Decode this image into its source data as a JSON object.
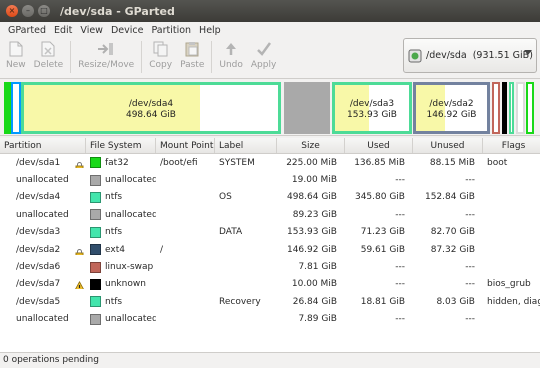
{
  "window": {
    "title": "/dev/sda - GParted"
  },
  "menu": [
    "GParted",
    "Edit",
    "View",
    "Device",
    "Partition",
    "Help"
  ],
  "toolbar": {
    "new": "New",
    "delete": "Delete",
    "resize_move": "Resize/Move",
    "copy": "Copy",
    "paste": "Paste",
    "undo": "Undo",
    "apply": "Apply"
  },
  "device_selector": {
    "device": "/dev/sda",
    "size": "(931.51 GiB)"
  },
  "graph": {
    "sda4": {
      "name": "/dev/sda4",
      "size": "498.64 GiB",
      "used_fraction": 0.693,
      "color": "#4ddb97"
    },
    "sda3": {
      "name": "/dev/sda3",
      "size": "153.93 GiB",
      "used_fraction": 0.463,
      "color": "#4ddb97"
    },
    "sda2": {
      "name": "/dev/sda2",
      "size": "146.92 GiB",
      "used_fraction": 0.406,
      "color": "#73829f"
    }
  },
  "columns": {
    "partition": "Partition",
    "filesystem": "File System",
    "mountpoint": "Mount Point",
    "label": "Label",
    "size": "Size",
    "used": "Used",
    "unused": "Unused",
    "flags": "Flags"
  },
  "rows": [
    {
      "partition": "/dev/sda1",
      "fs": "fat32",
      "fs_color": "#18d918",
      "mount": "/boot/efi",
      "label": "SYSTEM",
      "size": "225.00 MiB",
      "used": "136.85 MiB",
      "unused": "88.15 MiB",
      "flags": "boot",
      "icon": "lock-icon"
    },
    {
      "partition": "unallocated",
      "fs": "unallocated",
      "fs_color": "#a9a9a9",
      "mount": "",
      "label": "",
      "size": "19.00 MiB",
      "used": "---",
      "unused": "---",
      "flags": "",
      "icon": ""
    },
    {
      "partition": "/dev/sda4",
      "fs": "ntfs",
      "fs_color": "#42e5ac",
      "mount": "",
      "label": "OS",
      "size": "498.64 GiB",
      "used": "345.80 GiB",
      "unused": "152.84 GiB",
      "flags": "",
      "icon": ""
    },
    {
      "partition": "unallocated",
      "fs": "unallocated",
      "fs_color": "#a9a9a9",
      "mount": "",
      "label": "",
      "size": "89.23 GiB",
      "used": "---",
      "unused": "---",
      "flags": "",
      "icon": ""
    },
    {
      "partition": "/dev/sda3",
      "fs": "ntfs",
      "fs_color": "#42e5ac",
      "mount": "",
      "label": "DATA",
      "size": "153.93 GiB",
      "used": "71.23 GiB",
      "unused": "82.70 GiB",
      "flags": "",
      "icon": ""
    },
    {
      "partition": "/dev/sda2",
      "fs": "ext4",
      "fs_color": "#314e6c",
      "mount": "/",
      "label": "",
      "size": "146.92 GiB",
      "used": "59.61 GiB",
      "unused": "87.32 GiB",
      "flags": "",
      "icon": "lock-icon"
    },
    {
      "partition": "/dev/sda6",
      "fs": "linux-swap",
      "fs_color": "#c1665a",
      "mount": "",
      "label": "",
      "size": "7.81 GiB",
      "used": "---",
      "unused": "---",
      "flags": "",
      "icon": ""
    },
    {
      "partition": "/dev/sda7",
      "fs": "unknown",
      "fs_color": "#000000",
      "mount": "",
      "label": "",
      "size": "10.00 MiB",
      "used": "---",
      "unused": "---",
      "flags": "bios_grub",
      "icon": "warning-icon"
    },
    {
      "partition": "/dev/sda5",
      "fs": "ntfs",
      "fs_color": "#42e5ac",
      "mount": "",
      "label": "Recovery",
      "size": "26.84 GiB",
      "used": "18.81 GiB",
      "unused": "8.03 GiB",
      "flags": "hidden, diag",
      "icon": ""
    },
    {
      "partition": "unallocated",
      "fs": "unallocated",
      "fs_color": "#a9a9a9",
      "mount": "",
      "label": "",
      "size": "7.89 GiB",
      "used": "---",
      "unused": "---",
      "flags": "",
      "icon": ""
    }
  ],
  "status": {
    "text": "0 operations pending"
  },
  "colors": {
    "selection_border": "#0099ff",
    "ntfs": "#42e5ac",
    "fat32": "#18d918",
    "ext4": "#314e6c",
    "swap": "#c1665a",
    "unallocated": "#a9a9a9"
  }
}
